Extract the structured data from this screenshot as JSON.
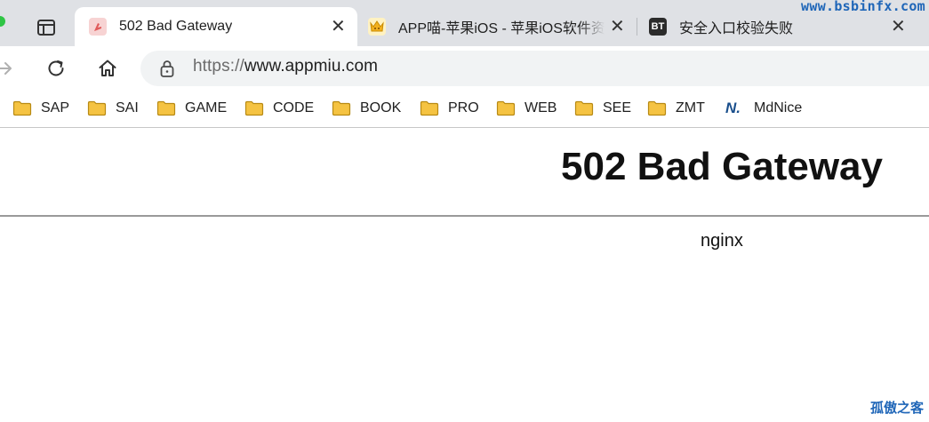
{
  "tabs": [
    {
      "title": "502 Bad Gateway",
      "favicon": "pink-hand-icon",
      "active": true
    },
    {
      "title": "APP喵-苹果iOS - 苹果iOS软件资",
      "favicon": "cat-crown-icon",
      "active": false
    },
    {
      "title": "安全入口校验失败",
      "favicon": "BT",
      "active": false
    }
  ],
  "toolbar": {
    "url_scheme": "https://",
    "url_host": "www.appmiu.com"
  },
  "bookmarks": [
    {
      "label": "SAP"
    },
    {
      "label": "SAI"
    },
    {
      "label": "GAME"
    },
    {
      "label": "CODE"
    },
    {
      "label": "BOOK"
    },
    {
      "label": "PRO"
    },
    {
      "label": "WEB"
    },
    {
      "label": "SEE"
    },
    {
      "label": "ZMT"
    },
    {
      "label": "MdNice",
      "icon_text": "N."
    }
  ],
  "page": {
    "heading": "502 Bad Gateway",
    "server": "nginx"
  },
  "watermarks": {
    "top": "www.bsbinfx.com",
    "bottom": "孤傲之客"
  },
  "colors": {
    "tabstrip": "#dfe1e5",
    "folder": "#f5c342",
    "watermark": "#1f66b8"
  }
}
